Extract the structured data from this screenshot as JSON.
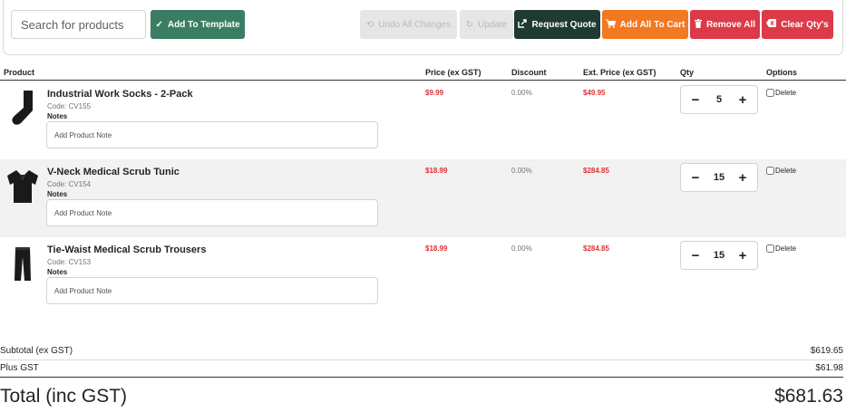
{
  "toolbar": {
    "search_placeholder": "Search for products",
    "add_to_template": "Add To Template",
    "undo_all": "Undo All Changes",
    "update": "Update",
    "request_quote": "Request Quote",
    "add_all_to_cart": "Add All To Cart",
    "remove_all": "Remove All",
    "clear_qtys": "Clear Qty's"
  },
  "table": {
    "headers": {
      "product": "Product",
      "price": "Price (ex GST)",
      "discount": "Discount",
      "ext_price": "Ext. Price (ex GST)",
      "qty": "Qty",
      "options": "Options"
    },
    "rows": [
      {
        "name": "Industrial Work Socks - 2-Pack",
        "code": "Code: CV155",
        "notes_label": "Notes",
        "note_placeholder": "Add Product Note",
        "price": "$9.99",
        "discount": "0.00%",
        "ext_price": "$49.95",
        "qty": "5",
        "delete_label": "Delete",
        "icon": "sock-icon"
      },
      {
        "name": "V-Neck Medical Scrub Tunic",
        "code": "Code: CV154",
        "notes_label": "Notes",
        "note_placeholder": "Add Product Note",
        "price": "$18.99",
        "discount": "0.00%",
        "ext_price": "$284.85",
        "qty": "15",
        "delete_label": "Delete",
        "icon": "tunic-icon"
      },
      {
        "name": "Tie-Waist Medical Scrub Trousers",
        "code": "Code: CV153",
        "notes_label": "Notes",
        "note_placeholder": "Add Product Note",
        "price": "$18.99",
        "discount": "0.00%",
        "ext_price": "$284.85",
        "qty": "15",
        "delete_label": "Delete",
        "icon": "trousers-icon"
      }
    ]
  },
  "totals": {
    "subtotal_label": "Subtotal (ex GST)",
    "subtotal_value": "$619.65",
    "gst_label": "Plus GST",
    "gst_value": "$61.98",
    "total_label": "Total (inc GST)",
    "total_value": "$681.63"
  },
  "colors": {
    "template_green": "#3b7d62",
    "quote_dark": "#1e3a33",
    "cart_orange": "#f27822",
    "danger_red": "#dc3a48",
    "price_red": "#e03131"
  }
}
